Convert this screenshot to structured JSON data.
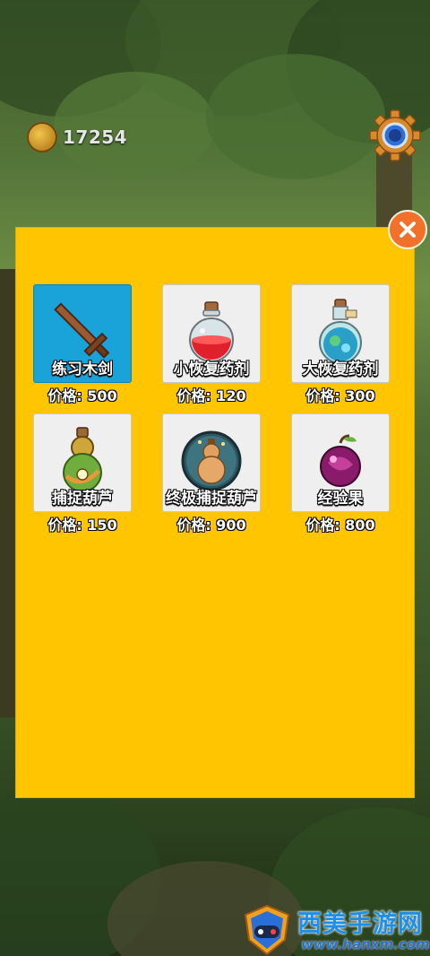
{
  "coins": {
    "icon": "coin-icon",
    "value": "17254"
  },
  "settings": {
    "icon": "gear-icon"
  },
  "shop": {
    "close_icon": "close-icon",
    "items": [
      {
        "name": "练习木剑",
        "price": "价格: 500",
        "icon": "wooden-sword-icon",
        "selected": true
      },
      {
        "name": "小恢复药剂",
        "price": "价格: 120",
        "icon": "red-potion-icon",
        "selected": false
      },
      {
        "name": "大恢复药剂",
        "price": "价格: 300",
        "icon": "blue-potion-icon",
        "selected": false
      },
      {
        "name": "捕捉葫芦",
        "price": "价格: 150",
        "icon": "capture-gourd-icon",
        "selected": false
      },
      {
        "name": "终极捕捉葫芦",
        "price": "价格: 900",
        "icon": "ultimate-gourd-icon",
        "selected": false
      },
      {
        "name": "经验果",
        "price": "价格: 800",
        "icon": "exp-fruit-icon",
        "selected": false
      }
    ]
  },
  "watermark": {
    "title": "西美手游网",
    "url": "www.hanxm.com",
    "icon": "gamepad-shield-icon"
  },
  "colors": {
    "panel": "#ffc600",
    "selected": "#1aa3d9",
    "close": "#f2712a"
  }
}
